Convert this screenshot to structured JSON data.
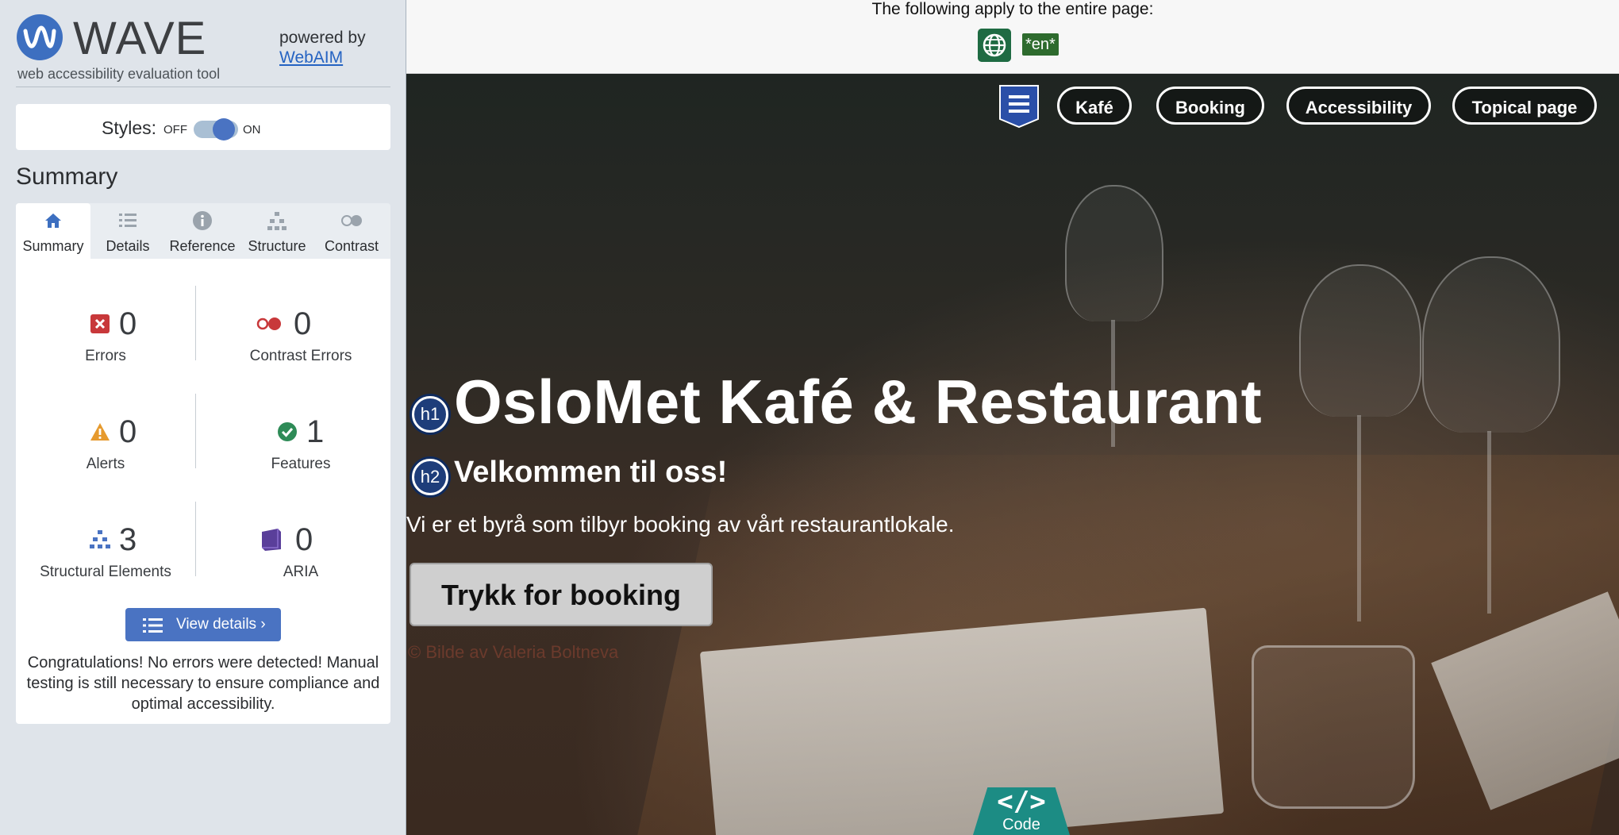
{
  "wave": {
    "logo_text": "WAVE",
    "tagline": "web accessibility evaluation tool",
    "powered_by": "powered by",
    "webaim_link": "WebAIM",
    "styles_label": "Styles:",
    "styles_off": "OFF",
    "styles_on": "ON",
    "styles_state": "on",
    "summary_heading": "Summary",
    "tabs": [
      {
        "label": "Summary",
        "icon": "home-icon",
        "active": true
      },
      {
        "label": "Details",
        "icon": "list-icon",
        "active": false
      },
      {
        "label": "Reference",
        "icon": "info-icon",
        "active": false
      },
      {
        "label": "Structure",
        "icon": "hierarchy-icon",
        "active": false
      },
      {
        "label": "Contrast",
        "icon": "contrast-icon",
        "active": false
      }
    ],
    "stats": {
      "errors": {
        "count": "0",
        "label": "Errors",
        "color": "#c8383a"
      },
      "contrast_errors": {
        "count": "0",
        "label": "Contrast Errors",
        "color": "#c8383a"
      },
      "alerts": {
        "count": "0",
        "label": "Alerts",
        "color": "#e69a2e"
      },
      "features": {
        "count": "1",
        "label": "Features",
        "color": "#2e8b57"
      },
      "structural": {
        "count": "3",
        "label": "Structural Elements",
        "color": "#4a73c2"
      },
      "aria": {
        "count": "0",
        "label": "ARIA",
        "color": "#5a3f9a"
      }
    },
    "view_details": "View details ›",
    "congrats": "Congratulations! No errors were detected! Manual testing is still necessary to ensure compliance and optimal accessibility."
  },
  "page": {
    "banner_text": "The following apply to the entire page:",
    "lang_tag": "*en*",
    "nav": {
      "links": [
        "Kafé",
        "Booking",
        "Accessibility",
        "Topical page"
      ]
    },
    "hero": {
      "h1_marker": "h1",
      "title": "OsloMet Kafé & Restaurant",
      "h2_marker": "h2",
      "subtitle": "Velkommen til oss!",
      "text": "Vi er et byrå som tilbyr booking av vårt restaurantlokale.",
      "button": "Trykk for booking",
      "credit": "© Bilde av Valeria Boltneva"
    },
    "code_tab": {
      "icon": "</>",
      "label": "Code"
    }
  },
  "colors": {
    "wave_accent": "#4a73c2",
    "sidebar_bg": "#dfe4ea",
    "code_tab": "#1c8c84"
  }
}
